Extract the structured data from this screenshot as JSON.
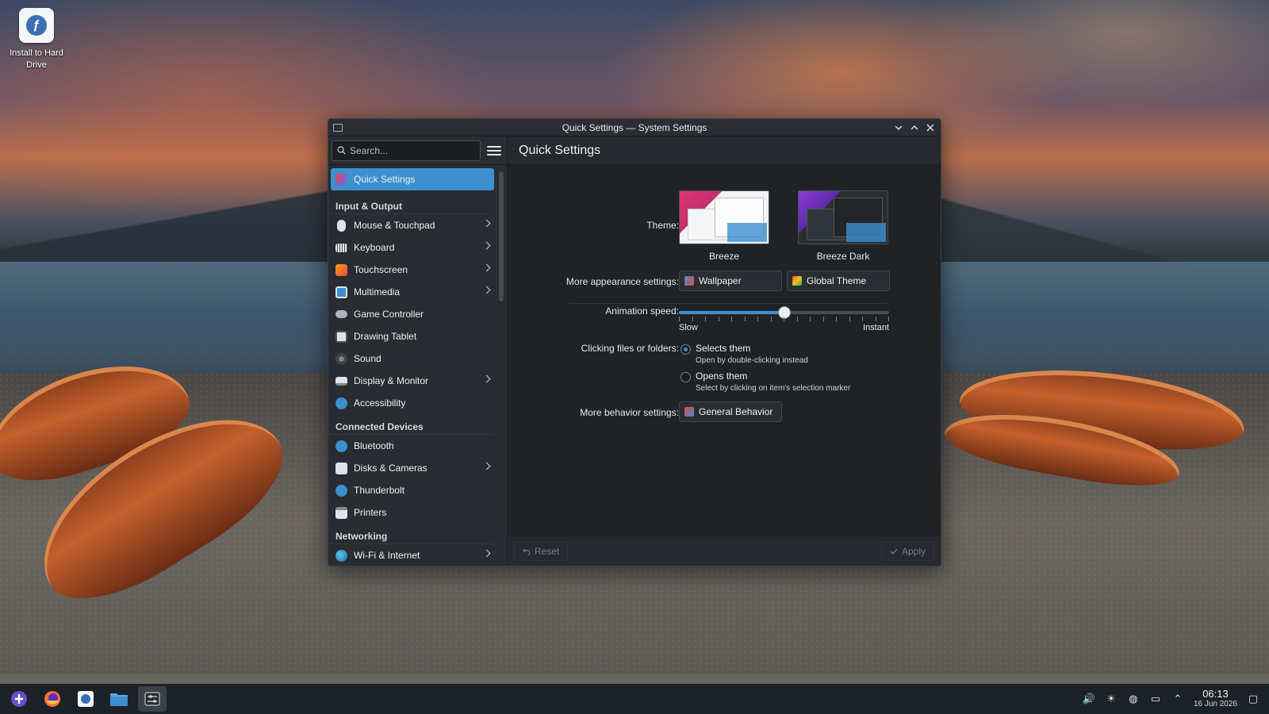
{
  "desktop": {
    "icon_label": "Install to Hard Drive"
  },
  "window": {
    "title": "Quick Settings — System Settings",
    "controls": [
      "minimize",
      "maximize",
      "close"
    ]
  },
  "sidebar": {
    "search_placeholder": "Search...",
    "active_item": "Quick Settings",
    "sections": [
      {
        "header": "Input & Output",
        "items": [
          {
            "label": "Mouse & Touchpad",
            "icon": "mouse-icon",
            "has_children": true
          },
          {
            "label": "Keyboard",
            "icon": "keyboard-icon",
            "has_children": true
          },
          {
            "label": "Touchscreen",
            "icon": "touchscreen-icon",
            "has_children": true
          },
          {
            "label": "Multimedia",
            "icon": "multimedia-icon",
            "has_children": true
          },
          {
            "label": "Game Controller",
            "icon": "gamepad-icon",
            "has_children": false
          },
          {
            "label": "Drawing Tablet",
            "icon": "tablet-icon",
            "has_children": false
          },
          {
            "label": "Sound",
            "icon": "speaker-icon",
            "has_children": false
          },
          {
            "label": "Display & Monitor",
            "icon": "monitor-icon",
            "has_children": true
          },
          {
            "label": "Accessibility",
            "icon": "accessibility-icon",
            "has_children": false
          }
        ]
      },
      {
        "header": "Connected Devices",
        "items": [
          {
            "label": "Bluetooth",
            "icon": "bluetooth-icon",
            "has_children": false
          },
          {
            "label": "Disks & Cameras",
            "icon": "disk-icon",
            "has_children": true
          },
          {
            "label": "Thunderbolt",
            "icon": "thunderbolt-icon",
            "has_children": false
          },
          {
            "label": "Printers",
            "icon": "printer-icon",
            "has_children": false
          }
        ]
      },
      {
        "header": "Networking",
        "items": [
          {
            "label": "Wi-Fi & Internet",
            "icon": "globe-icon",
            "has_children": true
          }
        ]
      }
    ]
  },
  "main": {
    "title": "Quick Settings",
    "theme_label": "Theme:",
    "themes": [
      {
        "name": "Breeze",
        "selected": true
      },
      {
        "name": "Breeze Dark",
        "selected": false
      }
    ],
    "appearance_label": "More appearance settings:",
    "appearance_buttons": [
      "Wallpaper",
      "Global Theme"
    ],
    "animation_label": "Animation speed:",
    "animation_min": "Slow",
    "animation_max": "Instant",
    "animation_value": 0.5,
    "clicking_label": "Clicking files or folders:",
    "click_options": [
      {
        "label": "Selects them",
        "hint": "Open by double-clicking instead",
        "checked": true
      },
      {
        "label": "Opens them",
        "hint": "Select by clicking on item's selection marker",
        "checked": false
      }
    ],
    "behavior_label": "More behavior settings:",
    "behavior_button": "General Behavior",
    "reset_label": "Reset",
    "apply_label": "Apply"
  },
  "taskbar": {
    "time": "06:13",
    "date": "16 Jun 2026"
  },
  "colors": {
    "accent": "#3d8fd0",
    "window_bg": "#202326",
    "sidebar_bg": "#292c30"
  }
}
